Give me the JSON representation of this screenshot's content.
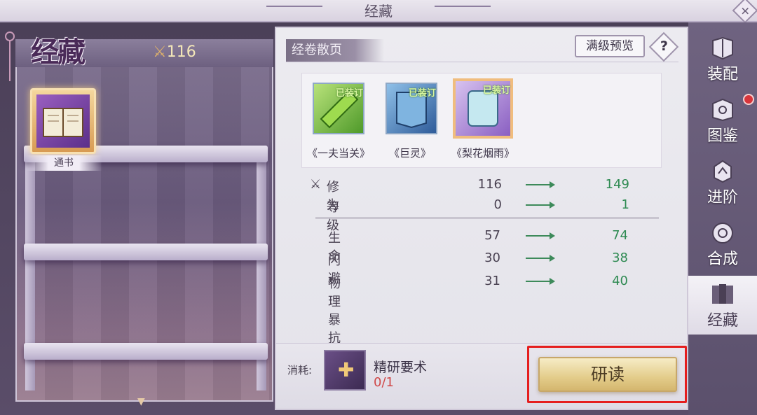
{
  "window": {
    "title": "经藏",
    "close_icon": "close-icon"
  },
  "left": {
    "title": "经藏",
    "power_value": "116",
    "selected_book": {
      "name": "通书"
    }
  },
  "section": {
    "title": "经卷散页"
  },
  "actions": {
    "preview_label": "满级预览",
    "help_label": "?"
  },
  "scrolls": [
    {
      "name": "《一夫当关》",
      "status": "已装订",
      "color": "#7ac23a"
    },
    {
      "name": "《巨灵》",
      "status": "已装订",
      "color": "#3f6fb0"
    },
    {
      "name": "《梨花烟雨》",
      "status": "已装订",
      "color": "#8d5fc8",
      "selected": true
    }
  ],
  "stats_top": [
    {
      "label": "修为",
      "from": "116",
      "to": "149"
    },
    {
      "label": "等级",
      "from": "0",
      "to": "1"
    }
  ],
  "stats_bottom": [
    {
      "label": "生命",
      "from": "57",
      "to": "74"
    },
    {
      "label": "闪避",
      "from": "30",
      "to": "38"
    },
    {
      "label": "物理暴抗",
      "from": "31",
      "to": "40"
    }
  ],
  "cost": {
    "label": "消耗:",
    "item_name": "精研要术",
    "count": "0/1"
  },
  "study_button": {
    "label": "研读"
  },
  "sidebar": {
    "tabs": [
      {
        "label": "装配",
        "icon": "equip-icon"
      },
      {
        "label": "图鉴",
        "icon": "codex-icon"
      },
      {
        "label": "进阶",
        "icon": "advance-icon"
      },
      {
        "label": "合成",
        "icon": "synthesis-icon"
      },
      {
        "label": "经藏",
        "icon": "scripture-icon",
        "active": true
      }
    ]
  },
  "colors": {
    "accent_gold": "#e3cc8a",
    "stat_increase": "#2e8a52",
    "cost_insufficient": "#d04848",
    "highlight_outline": "#e51e1e"
  }
}
